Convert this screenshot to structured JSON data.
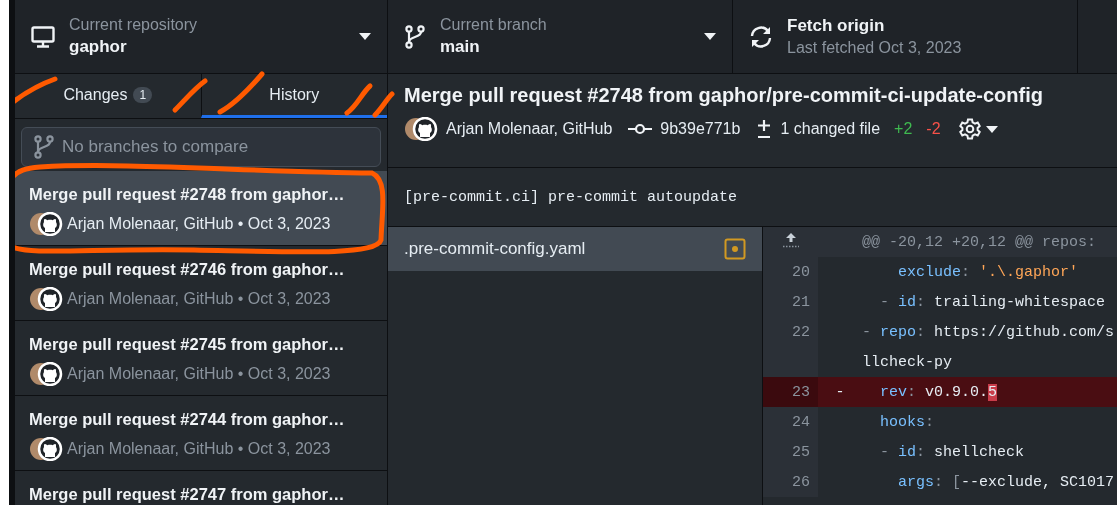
{
  "toolbar": {
    "repository": {
      "label": "Current repository",
      "value": "gaphor"
    },
    "branch": {
      "label": "Current branch",
      "value": "main"
    },
    "fetch": {
      "title": "Fetch origin",
      "subtitle": "Last fetched Oct 3, 2023"
    }
  },
  "sidebar": {
    "tabs": [
      {
        "label": "Changes",
        "badge": "1",
        "selected": false
      },
      {
        "label": "History",
        "selected": true
      }
    ],
    "filter": {
      "placeholder": "No branches to compare"
    },
    "commits": [
      {
        "title": "Merge pull request #2748 from gaphor…",
        "meta": "Arjan Molenaar, GitHub • Oct 3, 2023",
        "selected": true
      },
      {
        "title": "Merge pull request #2746 from gaphor…",
        "meta": "Arjan Molenaar, GitHub • Oct 3, 2023",
        "selected": false
      },
      {
        "title": "Merge pull request #2745 from gaphor…",
        "meta": "Arjan Molenaar, GitHub • Oct 3, 2023",
        "selected": false
      },
      {
        "title": "Merge pull request #2744 from gaphor…",
        "meta": "Arjan Molenaar, GitHub • Oct 3, 2023",
        "selected": false
      },
      {
        "title": "Merge pull request #2747 from gaphor…",
        "selected": false
      }
    ]
  },
  "commit": {
    "title": "Merge pull request #2748 from gaphor/pre-commit-ci-update-config",
    "authors": "Arjan Molenaar, GitHub",
    "sha": "9b39e771b",
    "changed_files": "1 changed file",
    "additions": "+2",
    "deletions": "-2",
    "description": "[pre-commit.ci] pre-commit autoupdate"
  },
  "files": [
    {
      "name": ".pre-commit-config.yaml",
      "kind": "modified",
      "selected": true
    }
  ],
  "diff": {
    "hunk_header": "@@ -20,12 +20,12 @@ repos:",
    "lines": [
      {
        "number": "20",
        "kind": "context",
        "tokens": [
          {
            "text": "    exclude",
            "kind": "key"
          },
          {
            "text": ": ",
            "kind": "punct"
          },
          {
            "text": "'.\\.gaphor'",
            "kind": "string"
          }
        ]
      },
      {
        "number": "21",
        "kind": "context",
        "tokens": [
          {
            "text": "  - ",
            "kind": "punct"
          },
          {
            "text": "id",
            "kind": "key"
          },
          {
            "text": ": ",
            "kind": "punct"
          },
          {
            "text": "trailing-whitespace",
            "kind": "text"
          }
        ]
      },
      {
        "number": "22",
        "kind": "context",
        "tokens": [
          {
            "text": "- ",
            "kind": "punct"
          },
          {
            "text": "repo",
            "kind": "key"
          },
          {
            "text": ": ",
            "kind": "punct"
          },
          {
            "text": "https://github.com/s",
            "kind": "text"
          }
        ]
      },
      {
        "kind": "context",
        "tokens": [
          {
            "text": "llcheck-py",
            "kind": "text"
          }
        ]
      },
      {
        "number": "23",
        "kind": "deleted",
        "marker": "-",
        "tokens": [
          {
            "text": "  rev",
            "kind": "key"
          },
          {
            "text": ": ",
            "kind": "punct"
          },
          {
            "text": "v0.9.0.",
            "kind": "text"
          },
          {
            "text": "5",
            "kind": "changed"
          }
        ]
      },
      {
        "number": "24",
        "kind": "context",
        "tokens": [
          {
            "text": "  hooks",
            "kind": "key"
          },
          {
            "text": ":",
            "kind": "punct"
          }
        ]
      },
      {
        "number": "25",
        "kind": "context",
        "tokens": [
          {
            "text": "  - ",
            "kind": "punct"
          },
          {
            "text": "id",
            "kind": "key"
          },
          {
            "text": ": ",
            "kind": "punct"
          },
          {
            "text": "shellcheck",
            "kind": "text"
          }
        ]
      },
      {
        "number": "26",
        "kind": "context",
        "tokens": [
          {
            "text": "    args",
            "kind": "key"
          },
          {
            "text": ": [",
            "kind": "punct"
          },
          {
            "text": "--exclude, SC1017",
            "kind": "text"
          }
        ]
      }
    ]
  }
}
